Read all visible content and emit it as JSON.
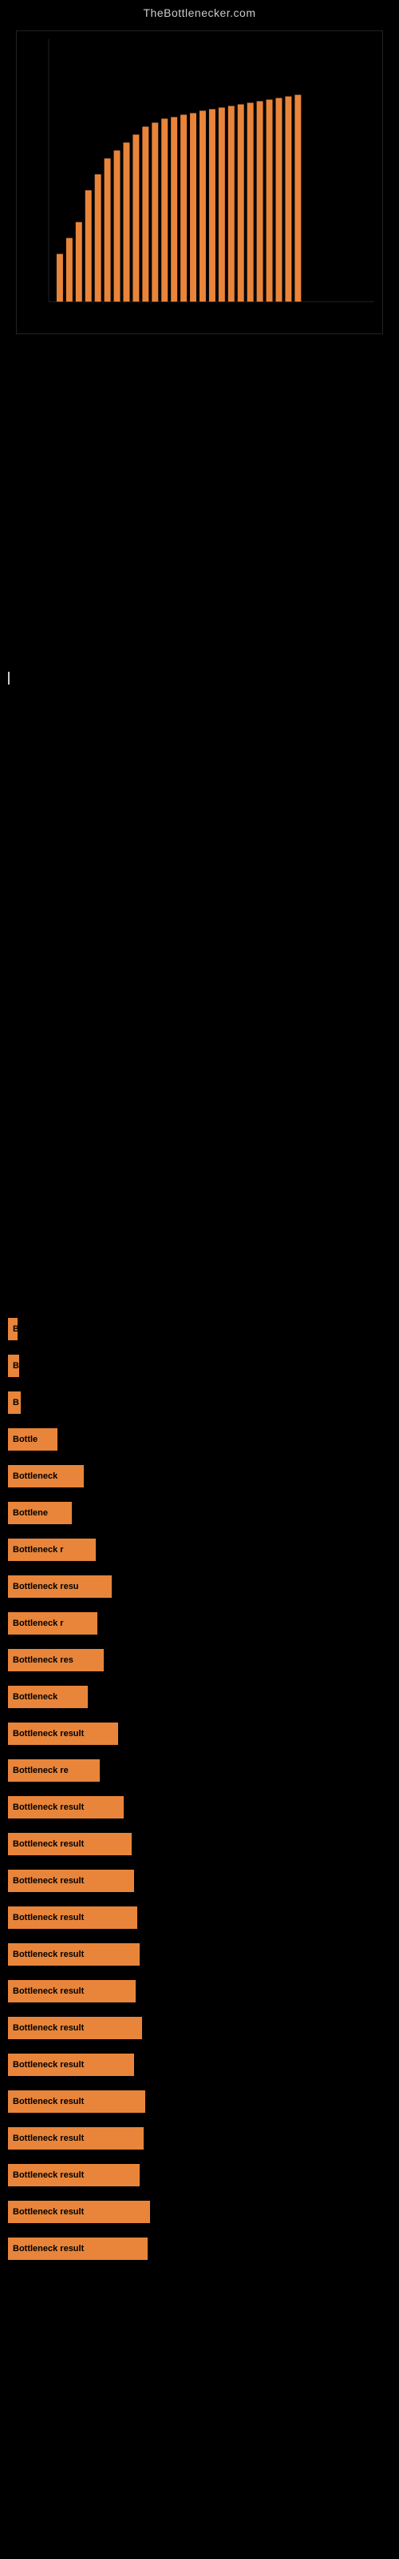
{
  "site": {
    "title": "TheBottlenecker.com"
  },
  "results": [
    {
      "id": 1,
      "label": "B",
      "bar_class": "rbar-1"
    },
    {
      "id": 2,
      "label": "B",
      "bar_class": "rbar-2"
    },
    {
      "id": 3,
      "label": "B",
      "bar_class": "rbar-3"
    },
    {
      "id": 4,
      "label": "Bottle",
      "bar_class": "rbar-4"
    },
    {
      "id": 5,
      "label": "Bottleneck",
      "bar_class": "rbar-5"
    },
    {
      "id": 6,
      "label": "Bottlene",
      "bar_class": "rbar-6"
    },
    {
      "id": 7,
      "label": "Bottleneck r",
      "bar_class": "rbar-7"
    },
    {
      "id": 8,
      "label": "Bottleneck resu",
      "bar_class": "rbar-8"
    },
    {
      "id": 9,
      "label": "Bottleneck r",
      "bar_class": "rbar-9"
    },
    {
      "id": 10,
      "label": "Bottleneck res",
      "bar_class": "rbar-10"
    },
    {
      "id": 11,
      "label": "Bottleneck",
      "bar_class": "rbar-11"
    },
    {
      "id": 12,
      "label": "Bottleneck result",
      "bar_class": "rbar-12"
    },
    {
      "id": 13,
      "label": "Bottleneck re",
      "bar_class": "rbar-13"
    },
    {
      "id": 14,
      "label": "Bottleneck result",
      "bar_class": "rbar-14"
    },
    {
      "id": 15,
      "label": "Bottleneck result",
      "bar_class": "rbar-15"
    },
    {
      "id": 16,
      "label": "Bottleneck result",
      "bar_class": "rbar-16"
    },
    {
      "id": 17,
      "label": "Bottleneck result",
      "bar_class": "rbar-17"
    },
    {
      "id": 18,
      "label": "Bottleneck result",
      "bar_class": "rbar-18"
    },
    {
      "id": 19,
      "label": "Bottleneck result",
      "bar_class": "rbar-19"
    },
    {
      "id": 20,
      "label": "Bottleneck result",
      "bar_class": "rbar-20"
    },
    {
      "id": 21,
      "label": "Bottleneck result",
      "bar_class": "rbar-21"
    },
    {
      "id": 22,
      "label": "Bottleneck result",
      "bar_class": "rbar-22"
    },
    {
      "id": 23,
      "label": "Bottleneck result",
      "bar_class": "rbar-23"
    },
    {
      "id": 24,
      "label": "Bottleneck result",
      "bar_class": "rbar-24"
    },
    {
      "id": 25,
      "label": "Bottleneck result",
      "bar_class": "rbar-25"
    },
    {
      "id": 26,
      "label": "Bottleneck result",
      "bar_class": "rbar-26"
    }
  ]
}
